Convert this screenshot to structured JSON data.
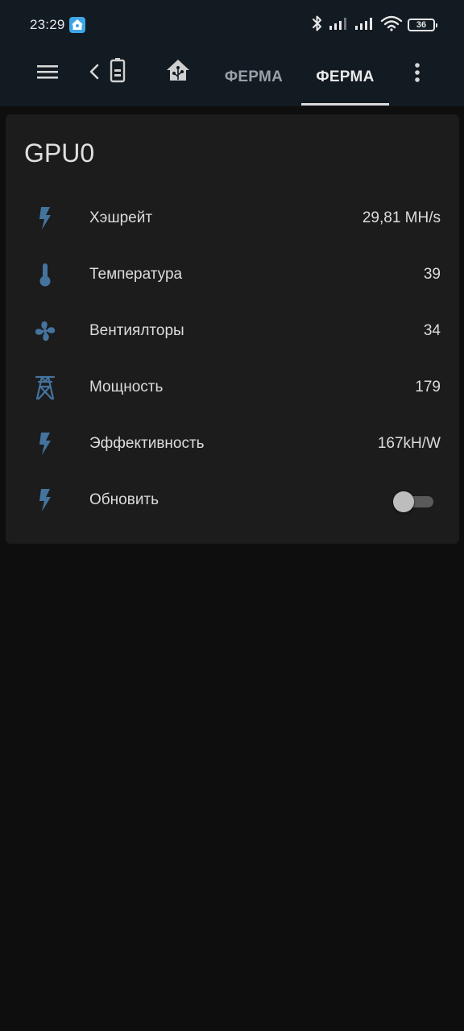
{
  "status_bar": {
    "time": "23:29",
    "battery_level": "36",
    "icons": [
      "home-assistant-badge-icon",
      "bluetooth-icon",
      "signal-icon",
      "signal-icon",
      "wifi-icon",
      "battery-icon"
    ]
  },
  "toolbar": {
    "menu_icon": "menu-icon",
    "back_icon": "chevron-left-icon",
    "tabs": [
      {
        "label": "",
        "icon": "battery-icon",
        "active": false
      },
      {
        "label": "",
        "icon": "home-assistant-icon",
        "active": false
      },
      {
        "label": "ФЕРМА",
        "active": false
      },
      {
        "label": "ФЕРМА",
        "active": true
      }
    ],
    "overflow_icon": "more-vertical-icon"
  },
  "card": {
    "title": "GPU0",
    "rows": [
      {
        "icon": "flash-icon",
        "label": "Хэшрейт",
        "value": "29,81 MH/s"
      },
      {
        "icon": "thermometer-icon",
        "label": "Температура",
        "value": "39"
      },
      {
        "icon": "fan-icon",
        "label": "Вентиялторы",
        "value": "34"
      },
      {
        "icon": "transmission-tower-icon",
        "label": "Мощность",
        "value": "179"
      },
      {
        "icon": "flash-icon",
        "label": "Эффективность",
        "value": "167kH/W"
      },
      {
        "icon": "flash-icon",
        "label": "Обновить",
        "toggle": false
      }
    ]
  },
  "colors": {
    "background": "#0e0e0e",
    "header": "#121a22",
    "card": "#1c1c1c",
    "icon_accent": "#44739e",
    "text": "#dcdcdc",
    "tab_inactive": "#9aa1a8"
  }
}
